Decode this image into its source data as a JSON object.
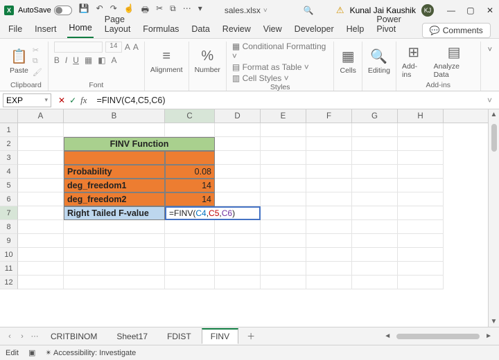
{
  "titlebar": {
    "autosave_label": "AutoSave",
    "filename": "sales.xlsx",
    "username": "Kunal Jai Kaushik",
    "avatar_initials": "KJ"
  },
  "menu": {
    "tabs": [
      "File",
      "Insert",
      "Home",
      "Page Layout",
      "Formulas",
      "Data",
      "Review",
      "View",
      "Developer",
      "Help",
      "Power Pivot"
    ],
    "active": "Home",
    "comments_label": "Comments"
  },
  "ribbon": {
    "paste_label": "Paste",
    "clipboard_label": "Clipboard",
    "font_label": "Font",
    "font_size": "14",
    "alignment_label": "Alignment",
    "number_label": "Number",
    "cond_fmt": "Conditional Formatting",
    "fmt_table": "Format as Table",
    "cell_styles": "Cell Styles",
    "styles_label": "Styles",
    "cells_label": "Cells",
    "editing_label": "Editing",
    "addins_btn": "Add-ins",
    "analyze_btn": "Analyze Data",
    "addins_label": "Add-ins"
  },
  "formula_bar": {
    "namebox": "EXP",
    "formula_plain": "=FINV(C4,C5,C6)",
    "prefix": "=FINV(",
    "ref1": "C4",
    "ref2": "C5",
    "ref3": "C6",
    "suffix": ")"
  },
  "columns": [
    "A",
    "B",
    "C",
    "D",
    "E",
    "F",
    "G",
    "H"
  ],
  "row_headers": [
    "1",
    "2",
    "3",
    "4",
    "5",
    "6",
    "7",
    "8",
    "9",
    "10",
    "11",
    "12"
  ],
  "cells": {
    "title": "FINV Function",
    "b4": "Probability",
    "c4": "0.08",
    "b5": "deg_freedom1",
    "c5": "14",
    "b6": "deg_freedom2",
    "c6": "14",
    "b7": "Right Tailed F-value"
  },
  "sheet_tabs": {
    "items": [
      "CRITBINOM",
      "Sheet17",
      "FDIST",
      "FINV"
    ],
    "active": "FINV"
  },
  "statusbar": {
    "mode": "Edit",
    "accessibility": "Accessibility: Investigate"
  }
}
